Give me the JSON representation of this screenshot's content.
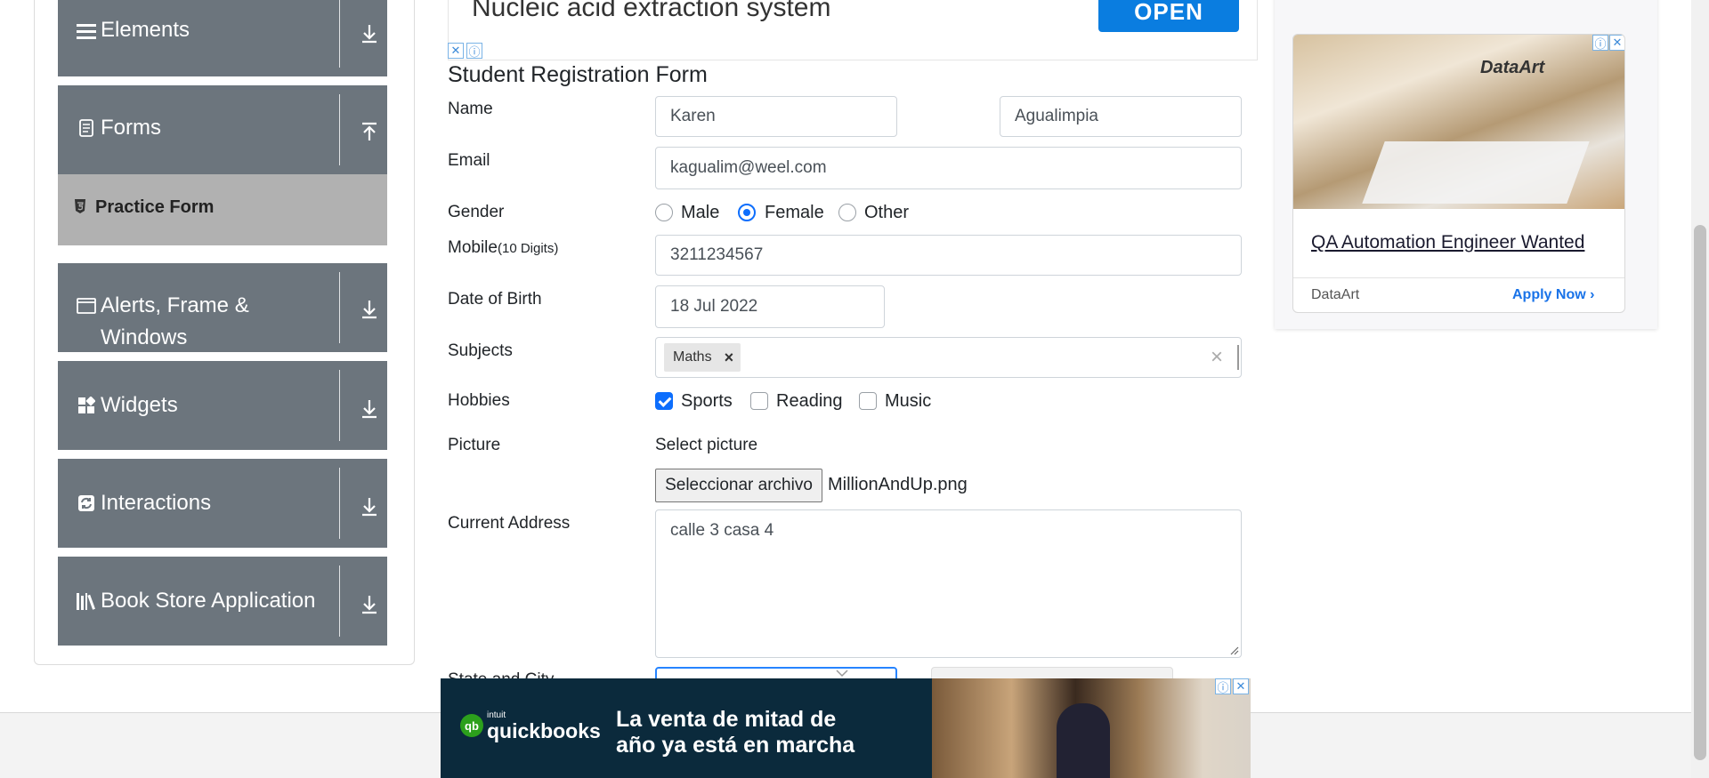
{
  "sidebar": {
    "groups": [
      {
        "label": "Elements",
        "icon": "hamburger-icon",
        "arrow": "download-arrow-icon"
      },
      {
        "label": "Forms",
        "icon": "document-icon",
        "arrow": "upload-arrow-icon"
      },
      {
        "label": "Alerts, Frame &",
        "label2": "Windows",
        "icon": "window-icon",
        "arrow": "download-arrow-icon"
      },
      {
        "label": "Widgets",
        "icon": "widgets-icon",
        "arrow": "download-arrow-icon"
      },
      {
        "label": "Interactions",
        "icon": "interactions-icon",
        "arrow": "download-arrow-icon"
      },
      {
        "label": "Book Store Application",
        "icon": "books-icon",
        "arrow": "download-arrow-icon"
      }
    ],
    "active_item": "Practice Form"
  },
  "top_ad": {
    "headline": "Nucleic acid extraction system",
    "button": "OPEN"
  },
  "form": {
    "title": "Student Registration Form",
    "name_label": "Name",
    "first_name": "Karen",
    "last_name": "Agualimpia",
    "email_label": "Email",
    "email": "kagualim@weel.com",
    "gender_label": "Gender",
    "gender_options": [
      "Male",
      "Female",
      "Other"
    ],
    "gender_selected": "Female",
    "mobile_label": "Mobile",
    "mobile_hint": "(10 Digits)",
    "mobile": "3211234567",
    "dob_label": "Date of Birth",
    "dob": "18 Jul 2022",
    "subjects_label": "Subjects",
    "subject_chip": "Maths",
    "chip_remove": "×",
    "clear_icon": "×",
    "hobbies_label": "Hobbies",
    "hobbies": [
      "Sports",
      "Reading",
      "Music"
    ],
    "hobbies_checked": [
      "Sports"
    ],
    "picture_label": "Picture",
    "picture_hint": "Select picture",
    "file_button": "Seleccionar archivo",
    "file_name": "MillionAndUp.png",
    "address_label": "Current Address",
    "address": "calle 3 casa 4",
    "state_city_label": "State and City"
  },
  "side_ad": {
    "brand": "DataArt",
    "headline": "QA Automation Engineer Wanted",
    "advertiser": "DataArt",
    "cta": "Apply Now"
  },
  "bottom_ad": {
    "brand_small": "intuit",
    "brand": "quickbooks",
    "text1": "La venta de mitad de",
    "text2": "año ya está en marcha"
  },
  "colors": {
    "sidebar_bg": "#6c757d",
    "active_bg": "#b1b1b1",
    "primary": "#0d6efd",
    "open_btn": "#0a7de0",
    "ad_dark": "#0b2a3c"
  }
}
